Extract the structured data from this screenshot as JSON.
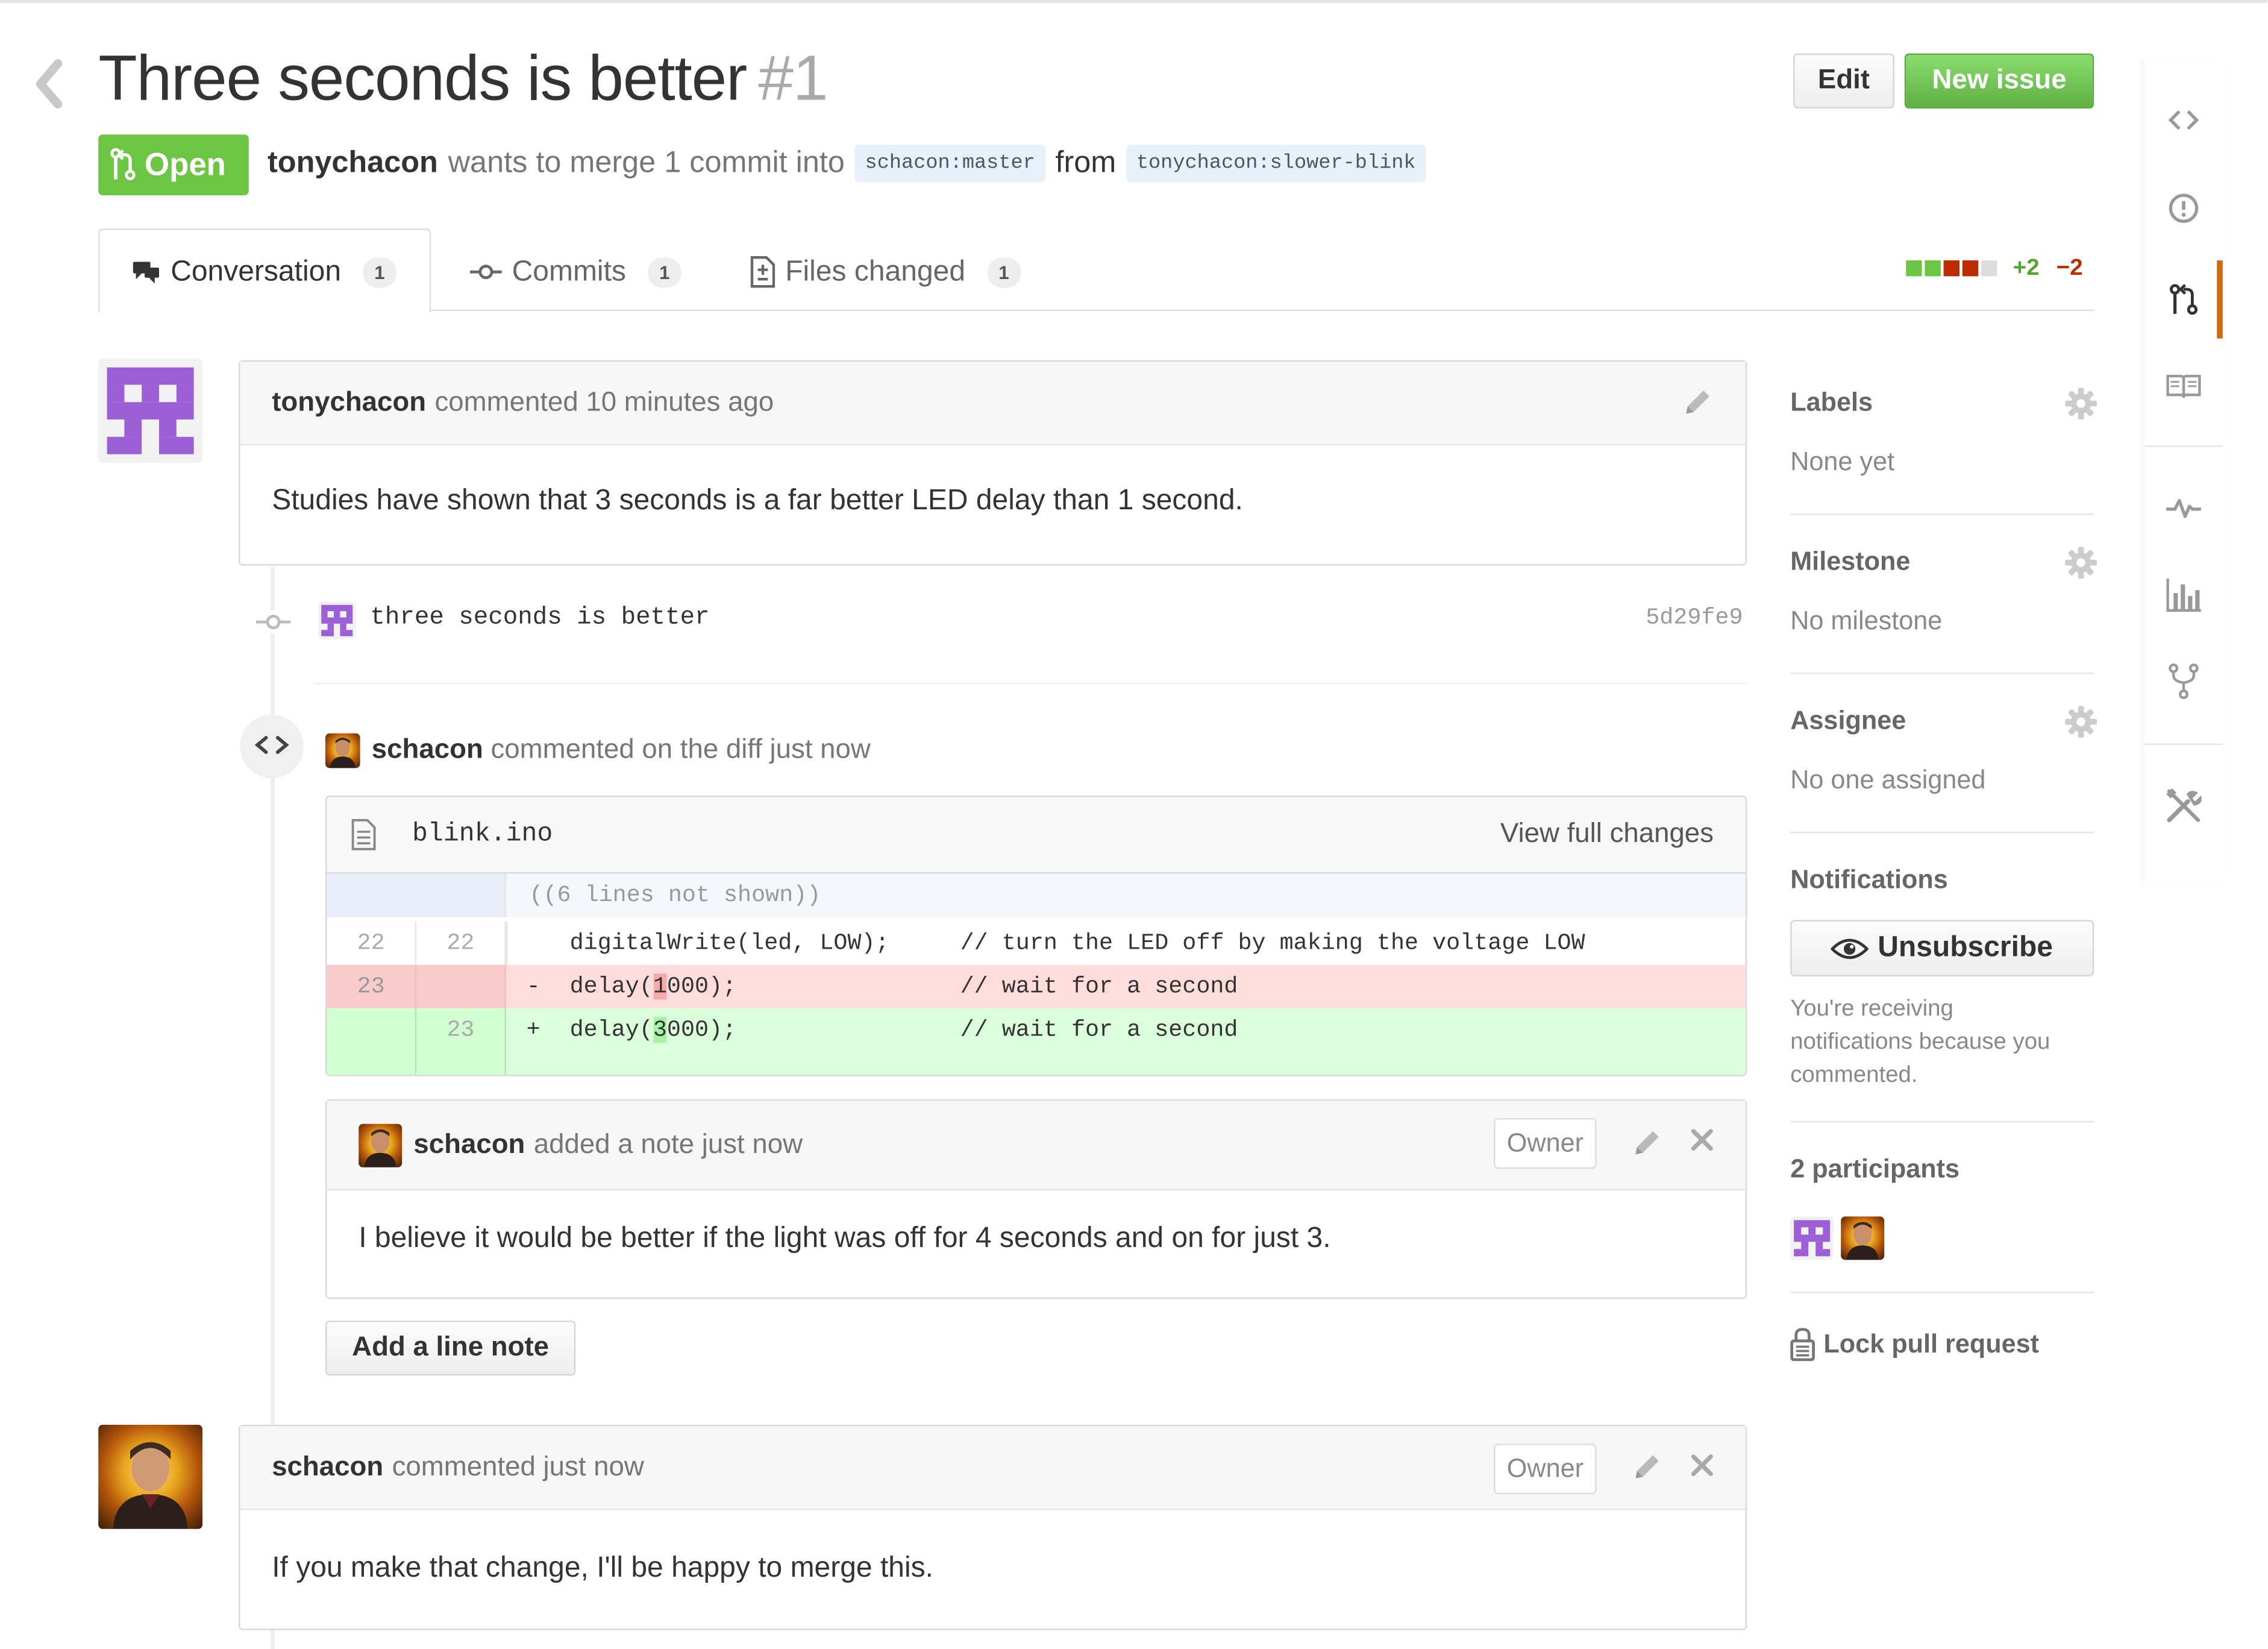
{
  "pr": {
    "title": "Three seconds is better",
    "number": "#1",
    "state": "Open",
    "author": "tonychacon",
    "merge_text": "wants to merge 1 commit into",
    "base_ref": "schacon:master",
    "from_word": "from",
    "head_ref": "tonychacon:slower-blink"
  },
  "actions": {
    "edit_label": "Edit",
    "new_issue_label": "New issue"
  },
  "tabs": [
    {
      "label": "Conversation",
      "count": "1"
    },
    {
      "label": "Commits",
      "count": "1"
    },
    {
      "label": "Files changed",
      "count": "1"
    }
  ],
  "diffstat": {
    "added": "+2",
    "removed": "−2"
  },
  "comment1": {
    "author": "tonychacon",
    "meta": "commented 10 minutes ago",
    "body": "Studies have shown that 3 seconds is a far better LED delay than 1 second."
  },
  "commit": {
    "message": "three seconds is better",
    "sha": "5d29fe9"
  },
  "diff_comment": {
    "author": "schacon",
    "meta": "commented on the diff just now",
    "file": "blink.ino",
    "view_full": "View full changes",
    "hunk": "((6 lines not shown))",
    "lines": [
      {
        "old": "22",
        "new": "22",
        "marker": " ",
        "code": "digitalWrite(led, LOW);",
        "comment": "// turn the LED off by making the voltage LOW"
      },
      {
        "old": "23",
        "new": "",
        "marker": "-",
        "code_before": "delay(",
        "code_hl": "1",
        "code_after": "000);",
        "comment": "// wait for a second"
      },
      {
        "old": "",
        "new": "23",
        "marker": "+",
        "code_before": "delay(",
        "code_hl": "3",
        "code_after": "000);",
        "comment": "// wait for a second"
      }
    ]
  },
  "line_note": {
    "author": "schacon",
    "meta": "added a note just now",
    "owner_badge": "Owner",
    "body": "I believe it would be better if the light was off for 4 seconds and on for just 3."
  },
  "add_line_note_label": "Add a line note",
  "comment2": {
    "author": "schacon",
    "meta": "commented just now",
    "owner_badge": "Owner",
    "body": "If you make that change, I'll be happy to merge this."
  },
  "sidebar": {
    "labels_title": "Labels",
    "labels_value": "None yet",
    "milestone_title": "Milestone",
    "milestone_value": "No milestone",
    "assignee_title": "Assignee",
    "assignee_value": "No one assigned",
    "notifications_title": "Notifications",
    "unsubscribe_label": "Unsubscribe",
    "notifications_text_1": "You're receiving",
    "notifications_text_2": "notifications because you",
    "notifications_text_3": "commented.",
    "participants_title": "2 participants",
    "lock_label": "Lock pull request"
  },
  "colors": {
    "open_green": "#6cc644",
    "new_issue_green": "#60b044",
    "deleted_bg": "#ffdddd",
    "added_bg": "#dbffdb",
    "accent_orange": "#d26911",
    "identicon_purple": "#9c5fd6"
  },
  "icons": {
    "back": "chevron-left-icon",
    "pull_request": "git-pull-request-icon",
    "comment": "comment-discussion-icon",
    "commit": "git-commit-icon",
    "files": "file-diff-icon",
    "edit": "pencil-icon",
    "close": "x-icon",
    "gear": "gear-icon",
    "eye": "eye-icon",
    "lock": "lock-icon",
    "code": "code-icon",
    "issue": "issue-opened-icon",
    "wiki": "book-icon",
    "pulse": "pulse-icon",
    "graph": "graph-icon",
    "fork": "repo-forked-icon",
    "settings": "tools-icon",
    "file": "file-text-icon",
    "expand": "unfold-icon"
  }
}
